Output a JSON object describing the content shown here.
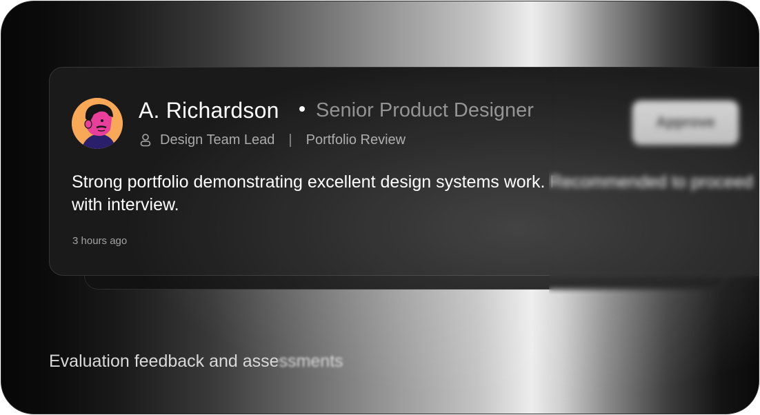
{
  "review_card": {
    "reviewer_name": "A. Richardson",
    "reviewer_role": "Senior Product Designer",
    "reviewer_department": "Design Team Lead",
    "review_type": "Portfolio Review",
    "separator": "|",
    "action_label": "Approve",
    "comment": "Strong portfolio demonstrating excellent design systems work. Recommended to proceed with interview.",
    "timestamp": "3 hours ago",
    "icons": {
      "avatar": "avatar-illustration",
      "meta": "person-icon"
    }
  },
  "caption": "Evaluation feedback and assessments",
  "colors": {
    "card_background": "#1a1a1a",
    "avatar_background": "#f9a858",
    "avatar_face": "#e8409a",
    "button_background": "#c8c8c8"
  }
}
